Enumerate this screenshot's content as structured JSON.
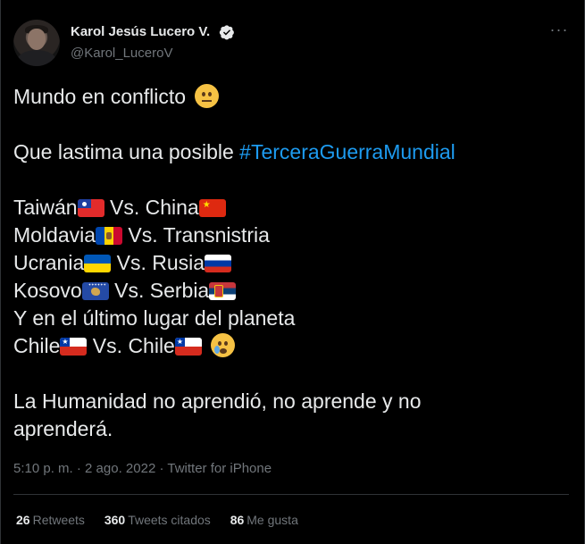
{
  "author": {
    "display_name": "Karol Jesús Lucero V.",
    "handle": "@Karol_LuceroV",
    "verified": true
  },
  "more_menu": "···",
  "tweet": {
    "line1": "Mundo en conflicto",
    "line2_prefix": "Que lastima una posible ",
    "hashtag": "#TerceraGuerraMundial",
    "conflicts": [
      {
        "left": "Taiwán",
        "vs": " Vs. ",
        "right": "China"
      },
      {
        "left": "Moldavia",
        "vs": " Vs. ",
        "right": "Transnistria"
      },
      {
        "left": "Ucrania",
        "vs": " Vs. ",
        "right": "Rusia"
      },
      {
        "left": "Kosovo",
        "vs": " Vs. ",
        "right": "Serbia"
      }
    ],
    "last_place": "Y en el último lugar del planeta",
    "chile_left": "Chile",
    "chile_vs": " Vs. ",
    "chile_right": "Chile",
    "closing_line1": "La Humanidad no aprendió, no aprende y no",
    "closing_line2": "aprenderá."
  },
  "meta": {
    "time": "5:10 p. m.",
    "separator": " · ",
    "date": "2 ago. 2022",
    "source": "Twitter for iPhone"
  },
  "stats": {
    "retweets_count": "26",
    "retweets_label": "Retweets",
    "quotes_count": "360",
    "quotes_label": "Tweets citados",
    "likes_count": "86",
    "likes_label": "Me gusta"
  },
  "colors": {
    "background": "#000000",
    "text": "#e7e9ea",
    "secondary": "#71767b",
    "link": "#1d9bf0",
    "border": "#2f3336"
  },
  "icons": [
    "verified-badge-icon",
    "more-options-icon",
    "neutral-face-emoji",
    "crying-face-emoji",
    "flag-taiwan",
    "flag-china",
    "flag-moldova",
    "flag-ukraine",
    "flag-russia",
    "flag-kosovo",
    "flag-serbia",
    "flag-chile"
  ]
}
